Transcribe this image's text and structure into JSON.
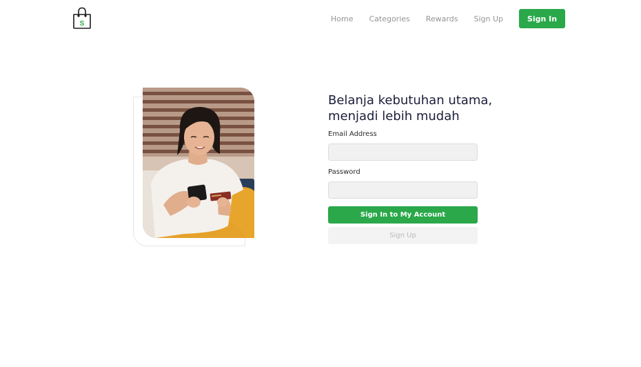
{
  "nav": {
    "logo_icon": "shopping-bag-icon",
    "logo_letter": "S",
    "links": [
      "Home",
      "Categories",
      "Rewards",
      "Sign Up"
    ],
    "signin_label": "Sign In"
  },
  "hero": {
    "image": "woman-with-phone-and-credit-card-photo"
  },
  "form": {
    "title_line1": "Belanja kebutuhan utama,",
    "title_line2": "menjadi lebih mudah",
    "email_label": "Email Address",
    "email_value": "",
    "password_label": "Password",
    "password_value": "",
    "submit_label": "Sign In to My Account",
    "signup_label": "Sign Up"
  },
  "colors": {
    "accent": "#2aa84a",
    "title": "#1b1e3a",
    "muted": "#949494",
    "input_bg": "#f1f1f1"
  }
}
